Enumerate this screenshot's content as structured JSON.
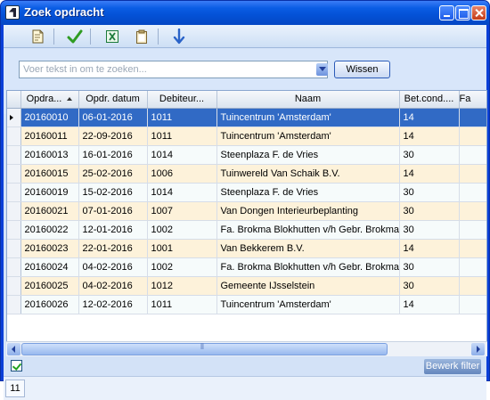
{
  "window": {
    "title": "Zoek opdracht"
  },
  "toolbar": {
    "buttons": [
      "new-document-icon",
      "check-icon",
      "excel-icon",
      "clipboard-icon",
      "down-arrow-icon"
    ]
  },
  "search": {
    "placeholder": "Voer tekst in om te zoeken...",
    "value": "",
    "clear_label": "Wissen"
  },
  "table": {
    "columns": [
      "Opdra...",
      "Opdr. datum",
      "Debiteur...",
      "Naam",
      "Bet.cond....",
      "Fa"
    ],
    "sorted_column": "Opdra...",
    "sort_direction": "ascending",
    "selected_row": 0,
    "rows": [
      [
        "20160010",
        "06-01-2016",
        "1011",
        "Tuincentrum 'Amsterdam'",
        "14",
        ""
      ],
      [
        "20160011",
        "22-09-2016",
        "1011",
        "Tuincentrum 'Amsterdam'",
        "14",
        ""
      ],
      [
        "20160013",
        "16-01-2016",
        "1014",
        "Steenplaza F. de Vries",
        "30",
        ""
      ],
      [
        "20160015",
        "25-02-2016",
        "1006",
        "Tuinwereld Van Schaik B.V.",
        "14",
        ""
      ],
      [
        "20160019",
        "15-02-2016",
        "1014",
        "Steenplaza F. de Vries",
        "30",
        ""
      ],
      [
        "20160021",
        "07-01-2016",
        "1007",
        "Van Dongen Interieurbeplanting",
        "30",
        ""
      ],
      [
        "20160022",
        "12-01-2016",
        "1002",
        "Fa. Brokma Blokhutten v/h Gebr. Brokma",
        "30",
        ""
      ],
      [
        "20160023",
        "22-01-2016",
        "1001",
        "Van Bekkerem B.V.",
        "14",
        ""
      ],
      [
        "20160024",
        "04-02-2016",
        "1002",
        "Fa. Brokma Blokhutten v/h Gebr. Brokma",
        "30",
        ""
      ],
      [
        "20160025",
        "04-02-2016",
        "1012",
        "Gemeente IJsselstein",
        "30",
        ""
      ],
      [
        "20160026",
        "12-02-2016",
        "1011",
        "Tuincentrum 'Amsterdam'",
        "14",
        ""
      ]
    ]
  },
  "filter": {
    "enabled": true,
    "edit_label": "Bewerk filter"
  },
  "status": {
    "count": "11"
  },
  "colors": {
    "selection": "#316ac5",
    "row_alt": "#fdf2da",
    "titlebar": "#0a5de4"
  }
}
